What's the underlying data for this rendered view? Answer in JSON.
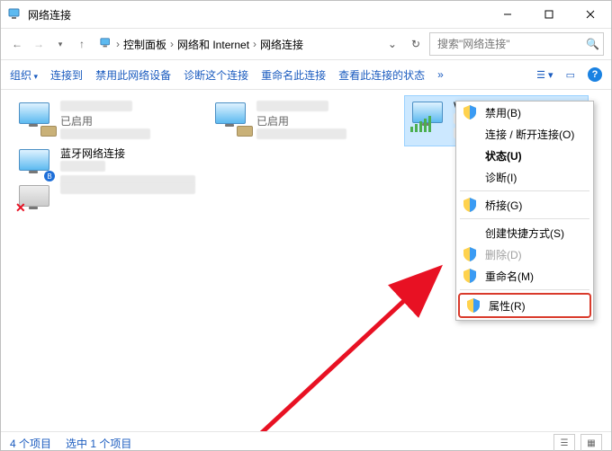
{
  "window": {
    "title": "网络连接"
  },
  "nav": {
    "crumb1": "控制面板",
    "crumb2": "网络和 Internet",
    "crumb3": "网络连接",
    "search_placeholder": "搜索\"网络连接\""
  },
  "toolbar": {
    "organize": "组织",
    "connect_to": "连接到",
    "disable_device": "禁用此网络设备",
    "diagnose": "诊断这个连接",
    "rename": "重命名此连接",
    "view_status": "查看此连接的状态",
    "more": "»"
  },
  "connections": [
    {
      "name": "",
      "sub1": "已启用",
      "sub2": "",
      "type": "eth",
      "blur_name": true
    },
    {
      "name": "",
      "sub1": "已启用",
      "sub2": "",
      "type": "eth",
      "blur_name": true
    },
    {
      "name": "WLAN",
      "sub1": "",
      "sub2": "",
      "type": "wifi",
      "selected": true,
      "blur_sub": true
    },
    {
      "name": "蓝牙网络连接",
      "sub1": "",
      "sub2": "",
      "type": "bt",
      "blur_sub": true
    },
    {
      "name": "",
      "sub1": "",
      "sub2": "",
      "type": "disabled",
      "blur_all": true
    }
  ],
  "context_menu": [
    {
      "label": "禁用(B)",
      "shield": true
    },
    {
      "label": "连接 / 断开连接(O)",
      "shield": false
    },
    {
      "label": "状态(U)",
      "bold": true
    },
    {
      "label": "诊断(I)"
    },
    {
      "sep": true
    },
    {
      "label": "桥接(G)",
      "shield": true
    },
    {
      "sep": true
    },
    {
      "label": "创建快捷方式(S)"
    },
    {
      "label": "删除(D)",
      "shield": true,
      "disabled": true
    },
    {
      "label": "重命名(M)",
      "shield": true
    },
    {
      "sep": true
    },
    {
      "label": "属性(R)",
      "shield": true,
      "highlight": true
    }
  ],
  "statusbar": {
    "items": "4 个项目",
    "selected": "选中 1 个项目"
  }
}
